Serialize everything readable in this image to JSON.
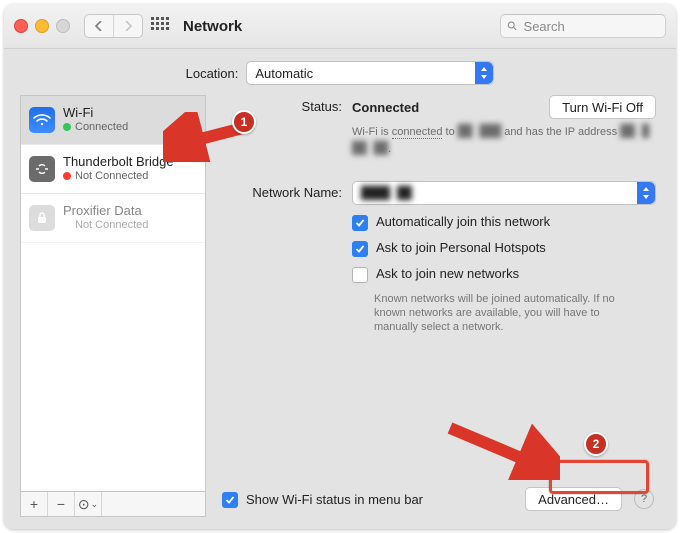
{
  "toolbar": {
    "title": "Network",
    "search_placeholder": "Search"
  },
  "location": {
    "label": "Location:",
    "value": "Automatic"
  },
  "sidebar": {
    "items": [
      {
        "name": "Wi-Fi",
        "status": "Connected"
      },
      {
        "name": "Thunderbolt Bridge",
        "status": "Not Connected"
      },
      {
        "name": "Proxifier Data",
        "status": "Not Connected"
      }
    ]
  },
  "detail": {
    "status_label": "Status:",
    "status_value": "Connected",
    "turn_off_label": "Turn Wi-Fi Off",
    "status_sub_before": "Wi-Fi is ",
    "status_sub_link": "connected",
    "status_sub_mid": " to ",
    "status_sub_ssid": "██ ███",
    "status_sub_after": " and has the IP address ",
    "status_sub_ip": "██ █ ██ ██",
    "status_sub_end": ".",
    "netname_label": "Network Name:",
    "netname_value": "████ ██",
    "auto_join": "Automatically join this network",
    "ask_hotspots": "Ask to join Personal Hotspots",
    "ask_new": "Ask to join new networks",
    "ask_new_help": "Known networks will be joined automatically. If no known networks are available, you will have to manually select a network.",
    "show_menubar": "Show Wi-Fi status in menu bar",
    "advanced_label": "Advanced…"
  },
  "badges": {
    "one": "1",
    "two": "2"
  }
}
